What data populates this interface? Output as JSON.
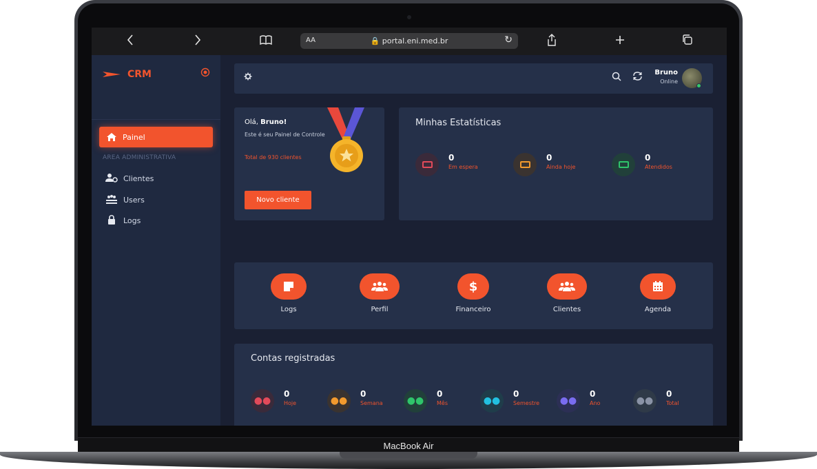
{
  "browser": {
    "back_icon": "chevron-left-icon",
    "forward_icon": "chevron-right-icon",
    "reader_icon": "book-icon",
    "text_size": "AA",
    "url": "portal.eni.med.br",
    "reload_icon": "reload-icon",
    "share_icon": "share-icon",
    "new_tab_icon": "plus-icon",
    "tabs_icon": "tabs-icon"
  },
  "sidebar": {
    "brand": "CRM",
    "accent": "#f2542d",
    "active_item": "Painel",
    "section": "AREA ADMINISTRATIVA",
    "items": [
      {
        "label": "Clientes",
        "icon": "users-cog-icon"
      },
      {
        "label": "Users",
        "icon": "id-cards-icon"
      },
      {
        "label": "Logs",
        "icon": "lock-icon"
      }
    ]
  },
  "topbar": {
    "user_name": "Bruno",
    "user_status": "Online"
  },
  "welcome": {
    "greeting_prefix": "Olá, ",
    "greeting_name": "Bruno!",
    "subtitle": "Este é seu Painel de Controle",
    "total": "Total de 930 clientes",
    "button": "Novo cliente"
  },
  "stats": {
    "title": "Minhas Estatísticas",
    "items": [
      {
        "value": "0",
        "label": "Em espera",
        "color": "#e24a5a"
      },
      {
        "value": "0",
        "label": "Ainda hoje",
        "color": "#f29a2e"
      },
      {
        "value": "0",
        "label": "Atendidos",
        "color": "#2fc46b"
      }
    ]
  },
  "shortcuts": [
    {
      "label": "Logs",
      "icon": "sticky-note-icon"
    },
    {
      "label": "Perfil",
      "icon": "users-icon"
    },
    {
      "label": "Financeiro",
      "icon": "dollar-icon"
    },
    {
      "label": "Clientes",
      "icon": "users-icon"
    },
    {
      "label": "Agenda",
      "icon": "calendar-icon"
    }
  ],
  "contas": {
    "title": "Contas registradas",
    "items": [
      {
        "value": "0",
        "label": "Hoje",
        "color": "#e24a5a"
      },
      {
        "value": "0",
        "label": "Semana",
        "color": "#f29a2e"
      },
      {
        "value": "0",
        "label": "Mês",
        "color": "#2fc46b"
      },
      {
        "value": "0",
        "label": "Semestre",
        "color": "#22c1e0"
      },
      {
        "value": "0",
        "label": "Ano",
        "color": "#7a6cf0"
      },
      {
        "value": "0",
        "label": "Total",
        "color": "#8a93a6"
      }
    ]
  },
  "device": {
    "label": "MacBook Air"
  }
}
